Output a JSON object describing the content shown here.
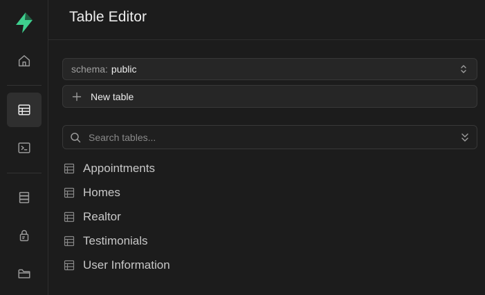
{
  "sidebar": {
    "logo_icon": "supabase-logo-icon",
    "accent_color": "#3ecf8e",
    "items": [
      {
        "name": "home",
        "icon": "home-icon",
        "active": false
      },
      {
        "name": "table-editor",
        "icon": "table-icon",
        "active": true
      },
      {
        "name": "sql-editor",
        "icon": "terminal-icon",
        "active": false
      },
      {
        "name": "database",
        "icon": "database-icon",
        "active": false
      },
      {
        "name": "authentication",
        "icon": "lock-icon",
        "active": false
      },
      {
        "name": "storage",
        "icon": "folder-icon",
        "active": false
      }
    ]
  },
  "header": {
    "title": "Table Editor"
  },
  "schema": {
    "label": "schema:",
    "value": "public"
  },
  "new_table": {
    "label": "New table"
  },
  "search": {
    "placeholder": "Search tables...",
    "value": ""
  },
  "tables": [
    {
      "name": "Appointments"
    },
    {
      "name": "Homes"
    },
    {
      "name": "Realtor"
    },
    {
      "name": "Testimonials"
    },
    {
      "name": "User Information"
    }
  ]
}
